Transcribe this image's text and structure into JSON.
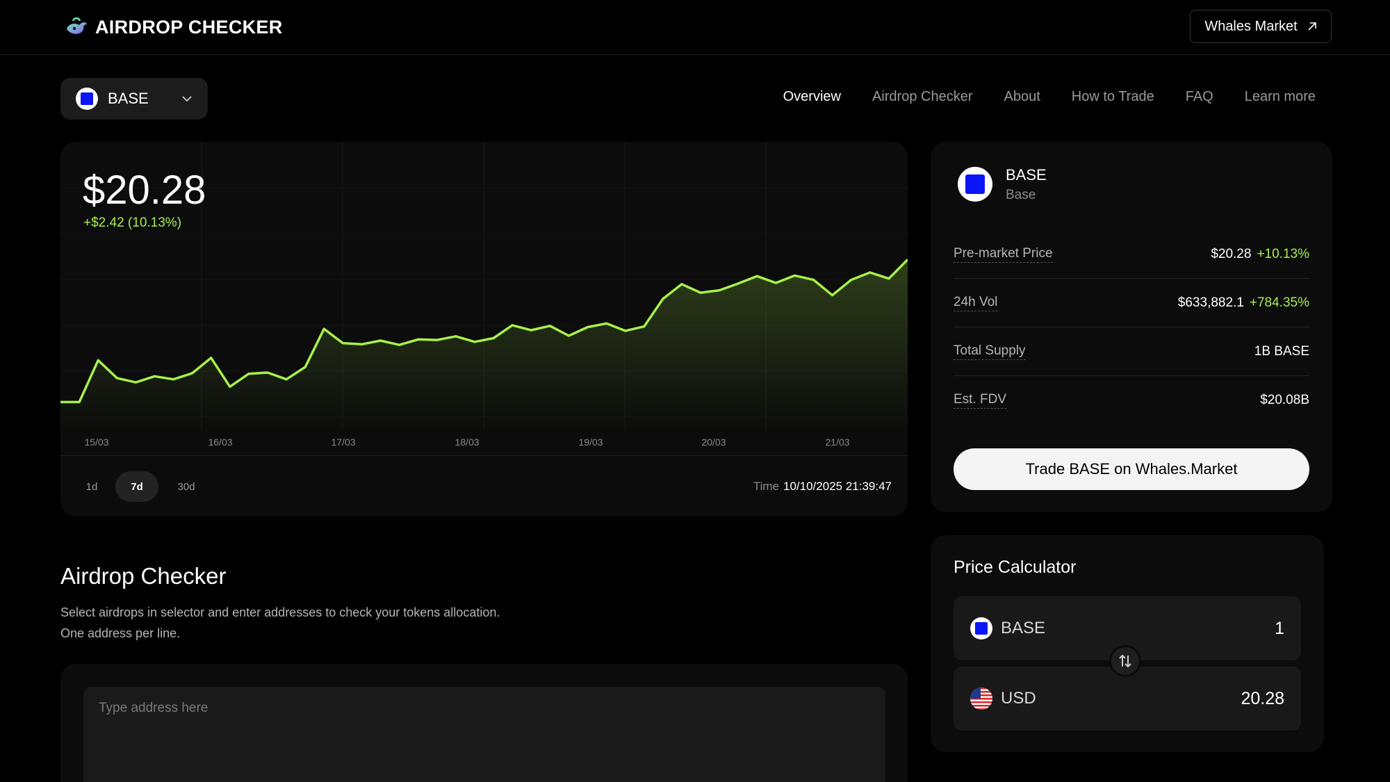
{
  "header": {
    "logo_text": "AIRDROP CHECKER",
    "external_button": "Whales Market",
    "external_icon": "arrow-up-right-icon"
  },
  "token_selector": {
    "selected": "BASE",
    "icon": "base-square-logo",
    "chevron_icon": "chevron-down-icon"
  },
  "nav": {
    "items": [
      "Overview",
      "Airdrop Checker",
      "About",
      "How to Trade",
      "FAQ",
      "Learn more"
    ],
    "active": "Overview"
  },
  "price_chart": {
    "price": "$20.28",
    "change": "+$2.42 (10.13%)",
    "x_ticks": [
      "15/03",
      "16/03",
      "17/03",
      "18/03",
      "19/03",
      "20/03",
      "21/03"
    ],
    "ranges": [
      "1d",
      "7d",
      "30d"
    ],
    "active_range": "7d",
    "time_label": "Time",
    "time_value": "10/10/2025 21:39:47"
  },
  "chart_data": {
    "type": "area",
    "x": [
      "15/03",
      "16/03",
      "17/03",
      "18/03",
      "19/03",
      "20/03",
      "21/03"
    ],
    "series": [
      {
        "values": [
          17.86,
          17.86,
          18.54,
          18.25,
          18.18,
          18.28,
          18.23,
          18.33,
          18.58,
          18.11,
          18.32,
          18.34,
          18.23,
          18.43,
          19.05,
          18.82,
          18.8,
          18.86,
          18.79,
          18.88,
          18.87,
          18.93,
          18.84,
          18.9,
          19.11,
          19.03,
          19.1,
          18.94,
          19.08,
          19.14,
          19.02,
          19.09,
          19.54,
          19.78,
          19.64,
          19.68,
          19.79,
          19.91,
          19.8,
          19.92,
          19.85,
          19.6,
          19.85,
          19.97,
          19.87,
          20.18
        ]
      }
    ],
    "color": "#a6f04a",
    "grid": true,
    "legend": "none"
  },
  "token_info": {
    "symbol": "BASE",
    "name": "Base",
    "stats": [
      {
        "label": "Pre-market Price",
        "value": "$20.28",
        "change": "+10.13%"
      },
      {
        "label": "24h Vol",
        "value": "$633,882.1",
        "change": "+784.35%"
      },
      {
        "label": "Total Supply",
        "value": "1B BASE",
        "change": ""
      },
      {
        "label": "Est. FDV",
        "value": "$20.08B",
        "change": ""
      }
    ],
    "trade_button": "Trade BASE on Whales.Market"
  },
  "calculator": {
    "title": "Price Calculator",
    "from": {
      "currency": "BASE",
      "amount": "1",
      "icon": "base-square-logo"
    },
    "to": {
      "currency": "USD",
      "amount": "20.28",
      "icon": "us-flag-icon"
    },
    "swap_icon": "swap-vertical-icon"
  },
  "airdrop_checker": {
    "title": "Airdrop Checker",
    "desc_line1": "Select airdrops in selector and enter addresses to check your tokens allocation.",
    "desc_line2": "One address per line.",
    "input_placeholder": "Type address here"
  },
  "colors": {
    "accent_green": "#a6f04a",
    "base_blue": "#0a16f5",
    "background": "#000000",
    "card": "#0c0c0c"
  }
}
